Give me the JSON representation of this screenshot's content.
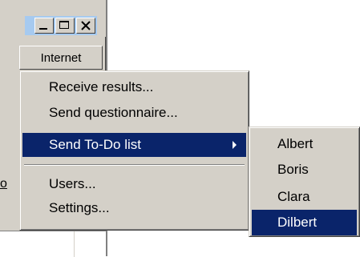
{
  "window": {
    "toolbar_button_label": "Internet",
    "partial_tab_label": "o"
  },
  "menu": {
    "items": [
      {
        "label": "Receive results..."
      },
      {
        "label": "Send questionnaire..."
      },
      {
        "label": "Send To-Do list",
        "has_submenu": true,
        "highlighted": true
      },
      {
        "label": "Users..."
      },
      {
        "label": "Settings..."
      }
    ]
  },
  "submenu": {
    "items": [
      {
        "label": "Albert"
      },
      {
        "label": "Boris"
      },
      {
        "label": "Clara"
      },
      {
        "label": "Dilbert",
        "highlighted": true
      }
    ]
  },
  "colors": {
    "face": "#d4d0c8",
    "highlight": "#0a246a",
    "title_inactive": "#a6caf0"
  }
}
